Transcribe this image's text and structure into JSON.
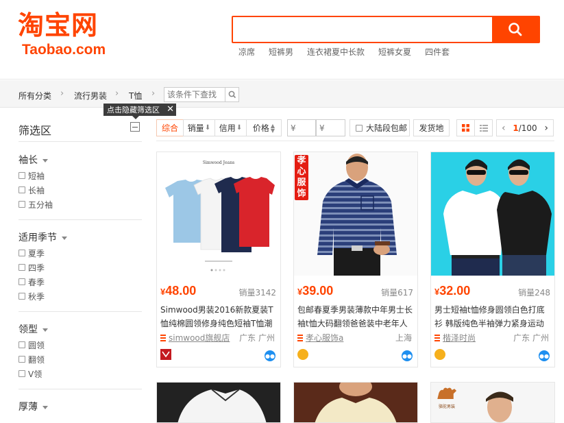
{
  "header": {
    "logo_cn": "淘宝网",
    "logo_en": "Taobao.com",
    "search_value": "",
    "hot_words": [
      "凉席",
      "短裤男",
      "连衣裙夏中长款",
      "短裤女夏",
      "四件套"
    ]
  },
  "breadcrumb": {
    "items": [
      "所有分类",
      "流行男装",
      "T恤"
    ],
    "search_placeholder": "该条件下查找"
  },
  "tooltip": {
    "text": "点击隐藏筛选区"
  },
  "sidebar": {
    "title": "筛选区",
    "groups": [
      {
        "title": "袖长",
        "options": [
          "短袖",
          "长袖",
          "五分袖"
        ]
      },
      {
        "title": "适用季节",
        "options": [
          "夏季",
          "四季",
          "春季",
          "秋季"
        ]
      },
      {
        "title": "领型",
        "options": [
          "圆领",
          "翻领",
          "V领"
        ]
      },
      {
        "title": "厚薄",
        "options": []
      }
    ]
  },
  "sortbar": {
    "composite": "综合",
    "sales": "销量",
    "credit": "信用",
    "price": "价格",
    "price_min_placeholder": "¥",
    "price_max_placeholder": "¥",
    "mainland_free_ship": "大陆段包邮",
    "ship_from": "发货地",
    "page_current": "1",
    "page_total": "/100"
  },
  "products": [
    {
      "price_symbol": "¥",
      "price": "48.00",
      "sales": "销量3142",
      "title": "Simwood男装2016新款夏装T恤纯棉圆领修身纯色短袖T恤潮男",
      "shop": "simwood旗舰店",
      "location": "广东 广州",
      "image_caption": "Simwood Jeans",
      "colors": [
        "#9cc7e6",
        "#ffffff",
        "#1f2b4e",
        "#d9242b"
      ]
    },
    {
      "price_symbol": "¥",
      "price": "39.00",
      "sales": "销量617",
      "title": "包邮春夏季男装薄款中年男士长袖t恤大码翻领爸爸装中老年人",
      "shop": "孝心服饰a",
      "location": "上海",
      "image_badge": "孝心服饰",
      "colors": [
        "#2b3f7a",
        "#7d8fb8"
      ]
    },
    {
      "price_symbol": "¥",
      "price": "32.00",
      "sales": "销量248",
      "title": "男士短袖t恤修身圆领白色打底衫 韩版纯色半袖弹力紧身运动",
      "shop": "楷泽时尚",
      "location": "广东 广州",
      "colors": [
        "#2ad0e6",
        "#ffffff",
        "#1b1b1b"
      ]
    }
  ],
  "bottom_row_brand": "骆驼男装"
}
